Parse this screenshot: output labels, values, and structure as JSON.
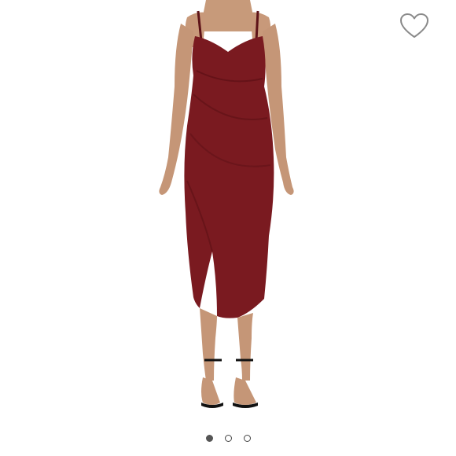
{
  "product": {
    "image": {
      "subject": "model-wearing-dress",
      "dress_color": "#7a1a20",
      "background": "#ffffff"
    }
  },
  "wishlist": {
    "icon": "heart-outline-icon",
    "color": "#8a8a8a"
  },
  "carousel": {
    "total_images": 3,
    "active_index": 0,
    "active_color": "#555555"
  }
}
